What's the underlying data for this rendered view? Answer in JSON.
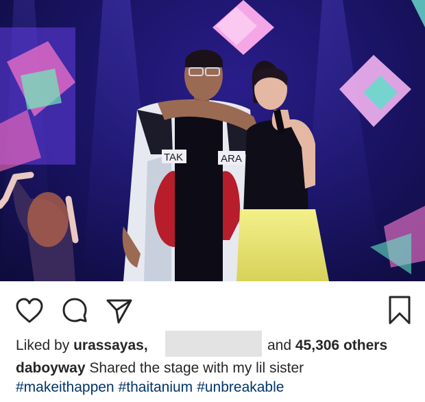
{
  "post": {
    "image_alt": "Two performers on a concert stage",
    "jacket_text_left": "TAK",
    "jacket_text_right": "ARA"
  },
  "actions": {
    "like_icon": "heart-icon",
    "comment_icon": "comment-icon",
    "share_icon": "send-icon",
    "save_icon": "bookmark-icon"
  },
  "likes": {
    "prefix": "Liked by ",
    "first_user": "urassayas,",
    "and_text": "and ",
    "count_text": "45,306 others"
  },
  "caption": {
    "username": "daboyway",
    "text": " Shared the stage with my lil sister",
    "hashtags": [
      "#makeithappen",
      "#thaitanium",
      "#unbreakable"
    ]
  },
  "colors": {
    "text": "#262626",
    "hashtag": "#003569",
    "redaction": "#e3e3e3"
  }
}
